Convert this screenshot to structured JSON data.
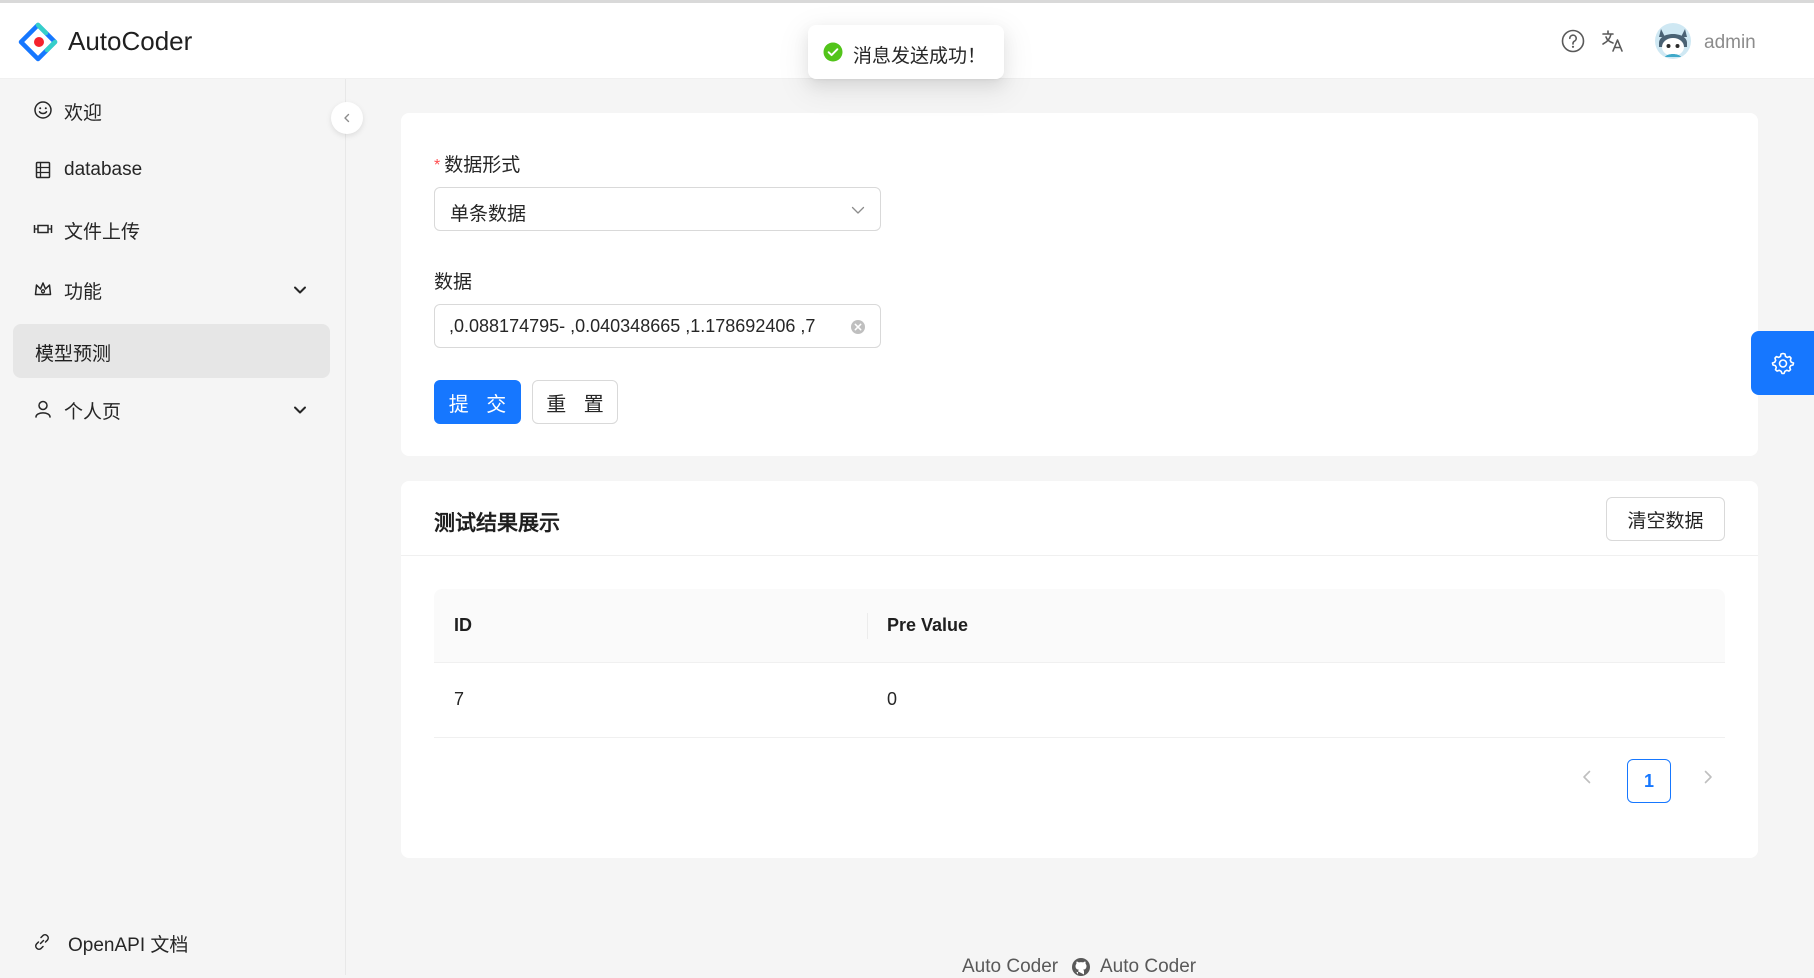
{
  "header": {
    "app_title": "AutoCoder",
    "help_icon": "question-circle-icon",
    "lang_icon": "translate-icon",
    "username": "admin"
  },
  "toast": {
    "message": "消息发送成功！",
    "icon": "check-circle-icon",
    "color": "#52c41a"
  },
  "sidebar": {
    "items": [
      {
        "label": "欢迎",
        "icon": "smile-icon"
      },
      {
        "label": "database",
        "icon": "table-icon"
      },
      {
        "label": "文件上传",
        "icon": "upload-icon"
      },
      {
        "label": "功能",
        "icon": "crown-icon",
        "expandable": true
      },
      {
        "label": "模型预测",
        "active": true
      },
      {
        "label": "个人页",
        "icon": "user-icon",
        "expandable": true
      }
    ],
    "footer_link": "OpenAPI 文档"
  },
  "form": {
    "format_label": "数据形式",
    "format_value": "单条数据",
    "data_label": "数据",
    "data_value": "7, 1.178692406, 0.040348665, -0.088174795,",
    "submit_label": "提 交",
    "reset_label": "重 置"
  },
  "results": {
    "title": "测试结果展示",
    "clear_label": "清空数据",
    "columns": [
      "ID",
      "Pre Value"
    ],
    "rows": [
      [
        "7",
        "0"
      ]
    ],
    "current_page": "1"
  },
  "footer": {
    "left": "Auto Coder",
    "right": "Auto Coder"
  },
  "colors": {
    "primary": "#1677ff",
    "required": "#ff4d4f"
  }
}
